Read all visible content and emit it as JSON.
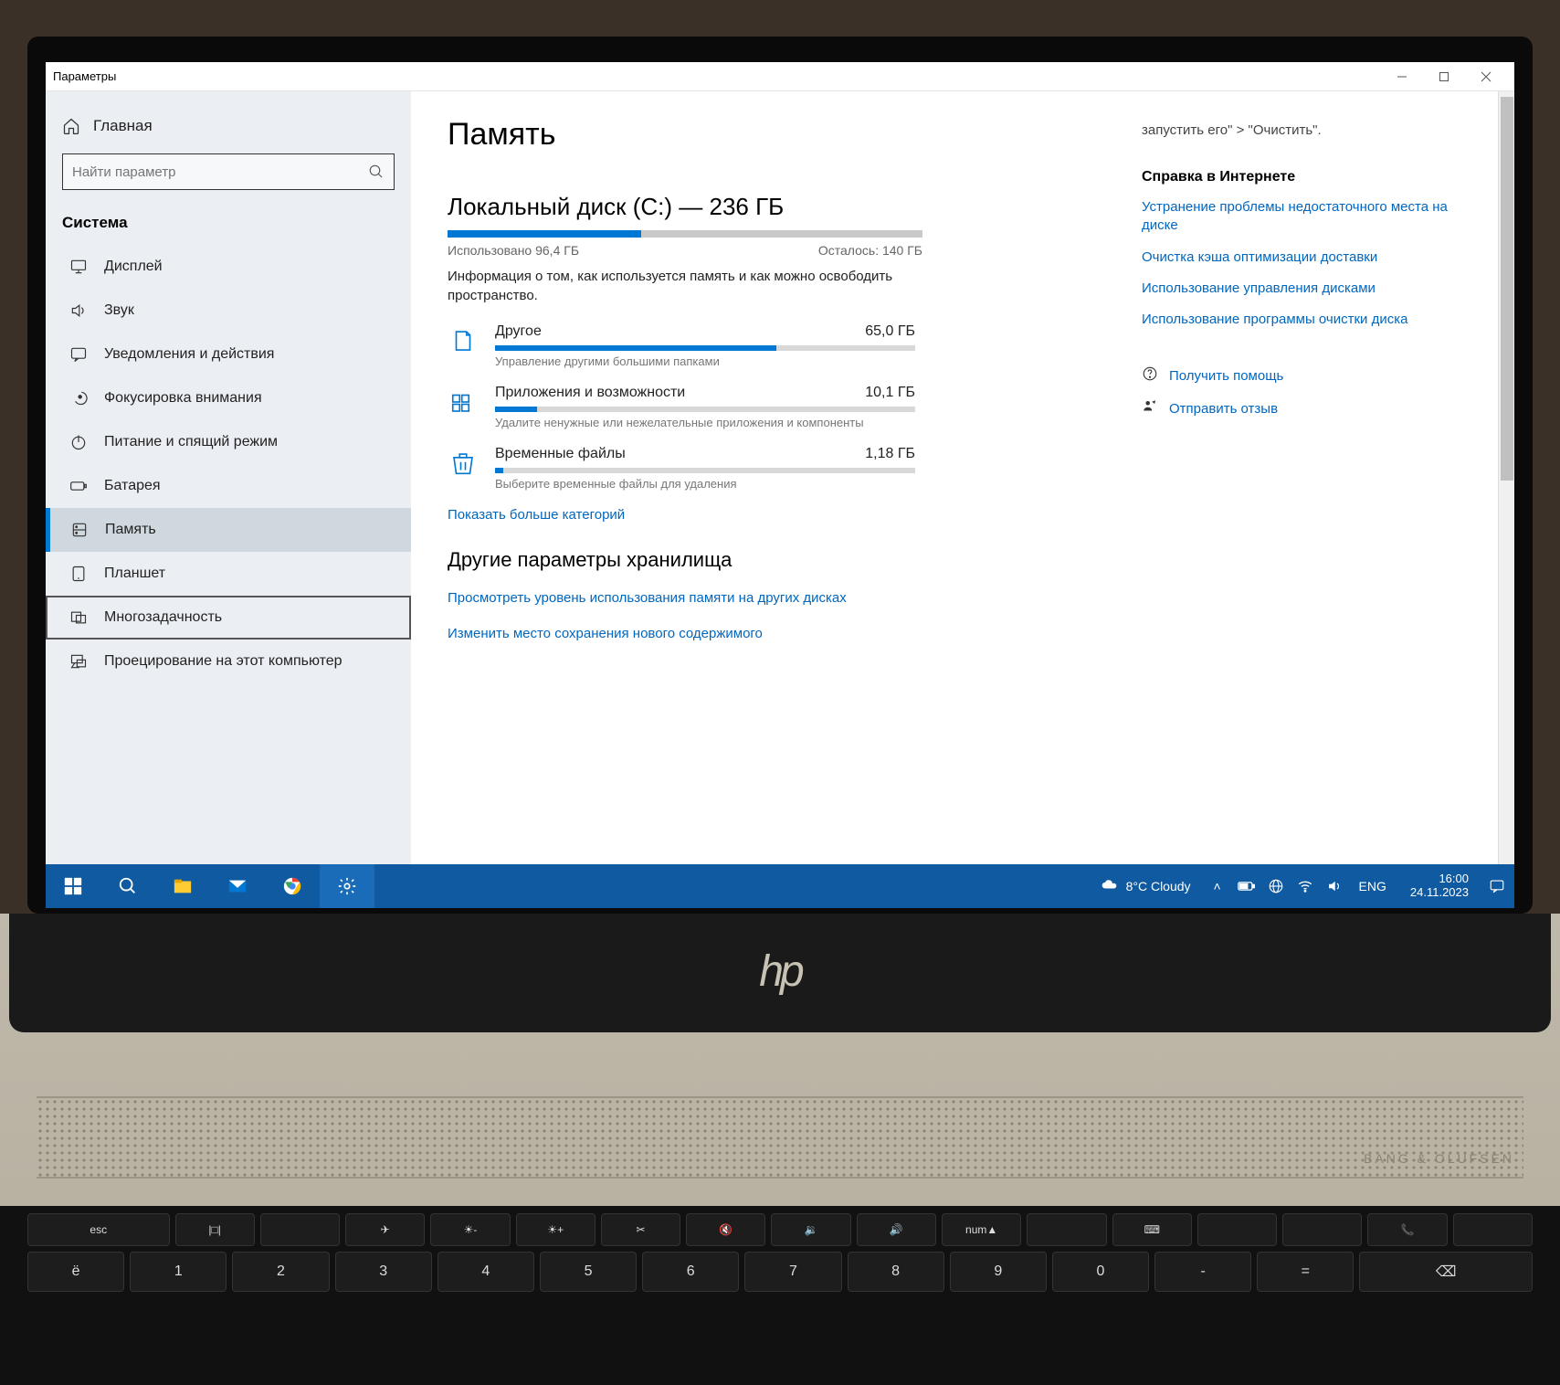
{
  "window": {
    "title": "Параметры"
  },
  "sidebar": {
    "home": "Главная",
    "search_placeholder": "Найти параметр",
    "section": "Система",
    "items": [
      {
        "label": "Дисплей",
        "icon": "display"
      },
      {
        "label": "Звук",
        "icon": "sound"
      },
      {
        "label": "Уведомления и действия",
        "icon": "notify"
      },
      {
        "label": "Фокусировка внимания",
        "icon": "focus"
      },
      {
        "label": "Питание и спящий режим",
        "icon": "power"
      },
      {
        "label": "Батарея",
        "icon": "battery"
      },
      {
        "label": "Память",
        "icon": "storage",
        "selected": true
      },
      {
        "label": "Планшет",
        "icon": "tablet"
      },
      {
        "label": "Многозадачность",
        "icon": "multitask",
        "boxed": true
      },
      {
        "label": "Проецирование на этот компьютер",
        "icon": "project"
      }
    ]
  },
  "main": {
    "title": "Память",
    "disk_title": "Локальный диск (C:) — 236 ГБ",
    "used_label": "Использовано 96,4 ГБ",
    "free_label": "Осталось: 140 ГБ",
    "used_percent": 40.8,
    "desc": "Информация о том, как используется память и как можно освободить пространство.",
    "categories": [
      {
        "label": "Другое",
        "size": "65,0 ГБ",
        "percent": 67,
        "sub": "Управление другими большими папками",
        "icon": "other"
      },
      {
        "label": "Приложения и возможности",
        "size": "10,1 ГБ",
        "percent": 10,
        "sub": "Удалите ненужные или нежелательные приложения и компоненты",
        "icon": "apps"
      },
      {
        "label": "Временные файлы",
        "size": "1,18 ГБ",
        "percent": 2,
        "sub": "Выберите временные файлы для удаления",
        "icon": "temp"
      }
    ],
    "more_link": "Показать больше категорий",
    "other_heading": "Другие параметры хранилища",
    "other_links": [
      "Просмотреть уровень использования памяти на других дисках",
      "Изменить место сохранения нового содержимого"
    ]
  },
  "right": {
    "hint": "запустить его\" > \"Очистить\".",
    "help_heading": "Справка в Интернете",
    "links": [
      "Устранение проблемы недостаточного места на диске",
      "Очистка кэша оптимизации доставки",
      "Использование управления дисками",
      "Использование программы очистки диска"
    ],
    "get_help": "Получить помощь",
    "feedback": "Отправить отзыв"
  },
  "taskbar": {
    "weather": "8°C  Cloudy",
    "lang": "ENG",
    "time": "16:00",
    "date": "24.11.2023"
  },
  "chassis": {
    "brand": "BANG & OLUFSEN",
    "fn_keys": [
      "esc",
      "|□|",
      "",
      "✈",
      "☀-",
      "☀+",
      "✂",
      "🔇",
      "🔉",
      "🔊",
      "num▲",
      "",
      "⌨",
      "",
      "",
      "📞",
      ""
    ],
    "row2": [
      "ё",
      "1",
      "2",
      "3",
      "4",
      "5",
      "6",
      "7",
      "8",
      "9",
      "0",
      "-",
      "=",
      "⌫"
    ]
  }
}
